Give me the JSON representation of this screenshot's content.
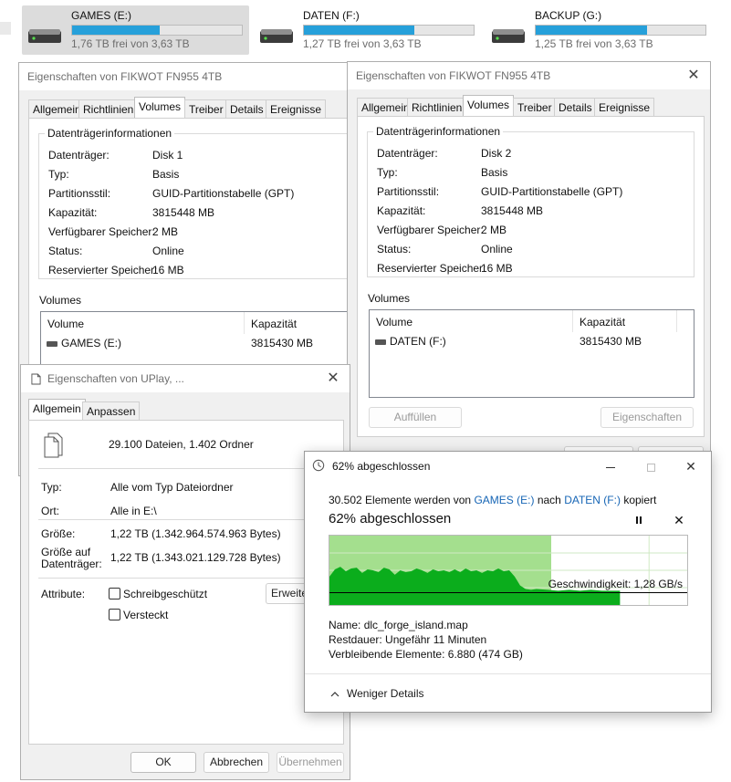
{
  "drives": [
    {
      "name": "GAMES (E:)",
      "free": "1,76 TB frei von 3,63 TB",
      "used_fraction": 0.515,
      "selected": true
    },
    {
      "name": "DATEN (F:)",
      "free": "1,27 TB frei von 3,63 TB",
      "used_fraction": 0.65,
      "selected": false
    },
    {
      "name": "BACKUP (G:)",
      "free": "1,25 TB frei von 3,63 TB",
      "used_fraction": 0.656,
      "selected": false
    }
  ],
  "disk_props_1": {
    "title": "Eigenschaften von FIKWOT FN955 4TB",
    "tabs": [
      "Allgemein",
      "Richtlinien",
      "Volumes",
      "Treiber",
      "Details",
      "Ereignisse"
    ],
    "group_title": "Datenträgerinformationen",
    "rows": [
      {
        "label": "Datenträger:",
        "value": "Disk 1"
      },
      {
        "label": "Typ:",
        "value": "Basis"
      },
      {
        "label": "Partitionsstil:",
        "value": "GUID-Partitionstabelle (GPT)"
      },
      {
        "label": "Kapazität:",
        "value": "3815448 MB"
      },
      {
        "label": "Verfügbarer Speicher:",
        "value": "2 MB"
      },
      {
        "label": "Status:",
        "value": "Online"
      },
      {
        "label": "Reservierter Speicher:",
        "value": "16 MB"
      }
    ],
    "volumes_label": "Volumes",
    "col_volume": "Volume",
    "col_capacity": "Kapazität",
    "volume_name": "GAMES (E:)",
    "volume_capacity": "3815430 MB"
  },
  "disk_props_2": {
    "title": "Eigenschaften von FIKWOT FN955 4TB",
    "tabs": [
      "Allgemein",
      "Richtlinien",
      "Volumes",
      "Treiber",
      "Details",
      "Ereignisse"
    ],
    "group_title": "Datenträgerinformationen",
    "rows": [
      {
        "label": "Datenträger:",
        "value": "Disk 2"
      },
      {
        "label": "Typ:",
        "value": "Basis"
      },
      {
        "label": "Partitionsstil:",
        "value": "GUID-Partitionstabelle (GPT)"
      },
      {
        "label": "Kapazität:",
        "value": "3815448 MB"
      },
      {
        "label": "Verfügbarer Speicher:",
        "value": "2 MB"
      },
      {
        "label": "Status:",
        "value": "Online"
      },
      {
        "label": "Reservierter Speicher:",
        "value": "16 MB"
      }
    ],
    "volumes_label": "Volumes",
    "col_volume": "Volume",
    "col_capacity": "Kapazität",
    "volume_name": "DATEN (F:)",
    "volume_capacity": "3815430 MB",
    "btn_fill": "Auffüllen",
    "btn_props": "Eigenschaften"
  },
  "folder_props": {
    "title": "Eigenschaften von UPlay, ...",
    "tabs": [
      "Allgemein",
      "Anpassen"
    ],
    "summary": "29.100 Dateien, 1.402 Ordner",
    "type_label": "Typ:",
    "type_value": "Alle vom Typ Dateiordner",
    "location_label": "Ort:",
    "location_value": "Alle in E:\\",
    "size_label": "Größe:",
    "size_value": "1,22 TB (1.342.964.574.963 Bytes)",
    "size_on_disk_label_1": "Größe auf",
    "size_on_disk_label_2": "Datenträger:",
    "size_on_disk_value": "1,22 TB (1.343.021.129.728 Bytes)",
    "attributes_label": "Attribute:",
    "readonly_label": "Schreibgeschützt",
    "hidden_label": "Versteckt",
    "advanced_label": "Erweite",
    "ok_label": "OK",
    "cancel_label": "Abbrechen",
    "apply_label": "Übernehmen"
  },
  "copy_dialog": {
    "title": "62% abgeschlossen",
    "desc_prefix": "30.502 Elemente werden von",
    "source": "GAMES (E:)",
    "desc_mid": "nach",
    "target": "DATEN (F:)",
    "desc_suffix": "kopiert",
    "heading": "62% abgeschlossen",
    "progress_percent": 62,
    "speed": "Geschwindigkeit: 1,28 GB/s",
    "name_label": "Name:",
    "name_value": "dlc_forge_island.map",
    "remaining_label": "Restdauer:",
    "remaining_value": "Ungefähr 11 Minuten",
    "items_label": "Verbleibende Elemente:",
    "items_value": "6.880 (474 GB)",
    "less_details": "Weniger Details"
  },
  "colors": {
    "accent": "#26a0da",
    "link": "#1665b5",
    "progress_light": "#a4df8e",
    "progress_dark": "#0bad1c"
  }
}
